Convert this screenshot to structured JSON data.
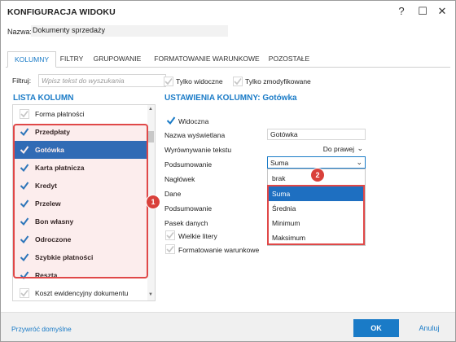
{
  "window": {
    "title": "KONFIGURACJA WIDOKU",
    "help_glyph": "?",
    "maximize_glyph": "☐",
    "close_glyph": "✕"
  },
  "name_row": {
    "label": "Nazwa:",
    "value": "Dokumenty sprzedaży"
  },
  "tabs": [
    {
      "label": "KOLUMNY",
      "active": true
    },
    {
      "label": "FILTRY",
      "active": false
    },
    {
      "label": "GRUPOWANIE",
      "active": false
    },
    {
      "label": "FORMATOWANIE WARUNKOWE",
      "active": false
    },
    {
      "label": "POZOSTAŁE",
      "active": false
    }
  ],
  "filter": {
    "label": "Filtruj:",
    "placeholder": "Wpisz tekst do wyszukania",
    "only_visible": "Tylko widoczne",
    "only_modified": "Tylko zmodyfikowane"
  },
  "columns_list": {
    "title": "LISTA KOLUMN",
    "items": [
      {
        "label": "Forma płatności",
        "checked": false,
        "bold": false,
        "selected": false
      },
      {
        "label": "Przedpłaty",
        "checked": true,
        "bold": true,
        "selected": false
      },
      {
        "label": "Gotówka",
        "checked": true,
        "bold": true,
        "selected": true
      },
      {
        "label": "Karta płatnicza",
        "checked": true,
        "bold": true,
        "selected": false
      },
      {
        "label": "Kredyt",
        "checked": true,
        "bold": true,
        "selected": false
      },
      {
        "label": "Przelew",
        "checked": true,
        "bold": true,
        "selected": false
      },
      {
        "label": "Bon własny",
        "checked": true,
        "bold": true,
        "selected": false
      },
      {
        "label": "Odroczone",
        "checked": true,
        "bold": true,
        "selected": false
      },
      {
        "label": "Szybkie płatności",
        "checked": true,
        "bold": true,
        "selected": false
      },
      {
        "label": "Reszta",
        "checked": true,
        "bold": true,
        "selected": false
      },
      {
        "label": "Koszt ewidencyjny dokumentu",
        "checked": false,
        "bold": false,
        "selected": false
      }
    ]
  },
  "settings": {
    "title": "USTAWIENIA KOLUMNY: Gotówka",
    "visible_label": "Widoczna",
    "display_name_label": "Nazwa wyświetlana",
    "display_name_value": "Gotówka",
    "alignment_label": "Wyrównywanie tekstu",
    "alignment_value": "Do prawej",
    "summary_label": "Podsumowanie",
    "summary_value": "Suma",
    "header_label": "Nagłówek",
    "data_label": "Dane",
    "summary2_label": "Podsumowanie",
    "data_bar_label": "Pasek danych",
    "uppercase_label": "Wielkie litery",
    "conditional_format_label": "Formatowanie warunkowe"
  },
  "summary_dropdown": {
    "options": [
      "brak",
      "Suma",
      "Średnia",
      "Minimum",
      "Maksimum"
    ],
    "selected": "Suma"
  },
  "badges": {
    "one": "1",
    "two": "2"
  },
  "footer": {
    "reset_label": "Przywróć domyślne",
    "ok_label": "OK",
    "cancel_label": "Anuluj"
  },
  "colors": {
    "accent": "#1a7bc7",
    "selection": "#1e6fc1",
    "highlight": "#e04848"
  }
}
